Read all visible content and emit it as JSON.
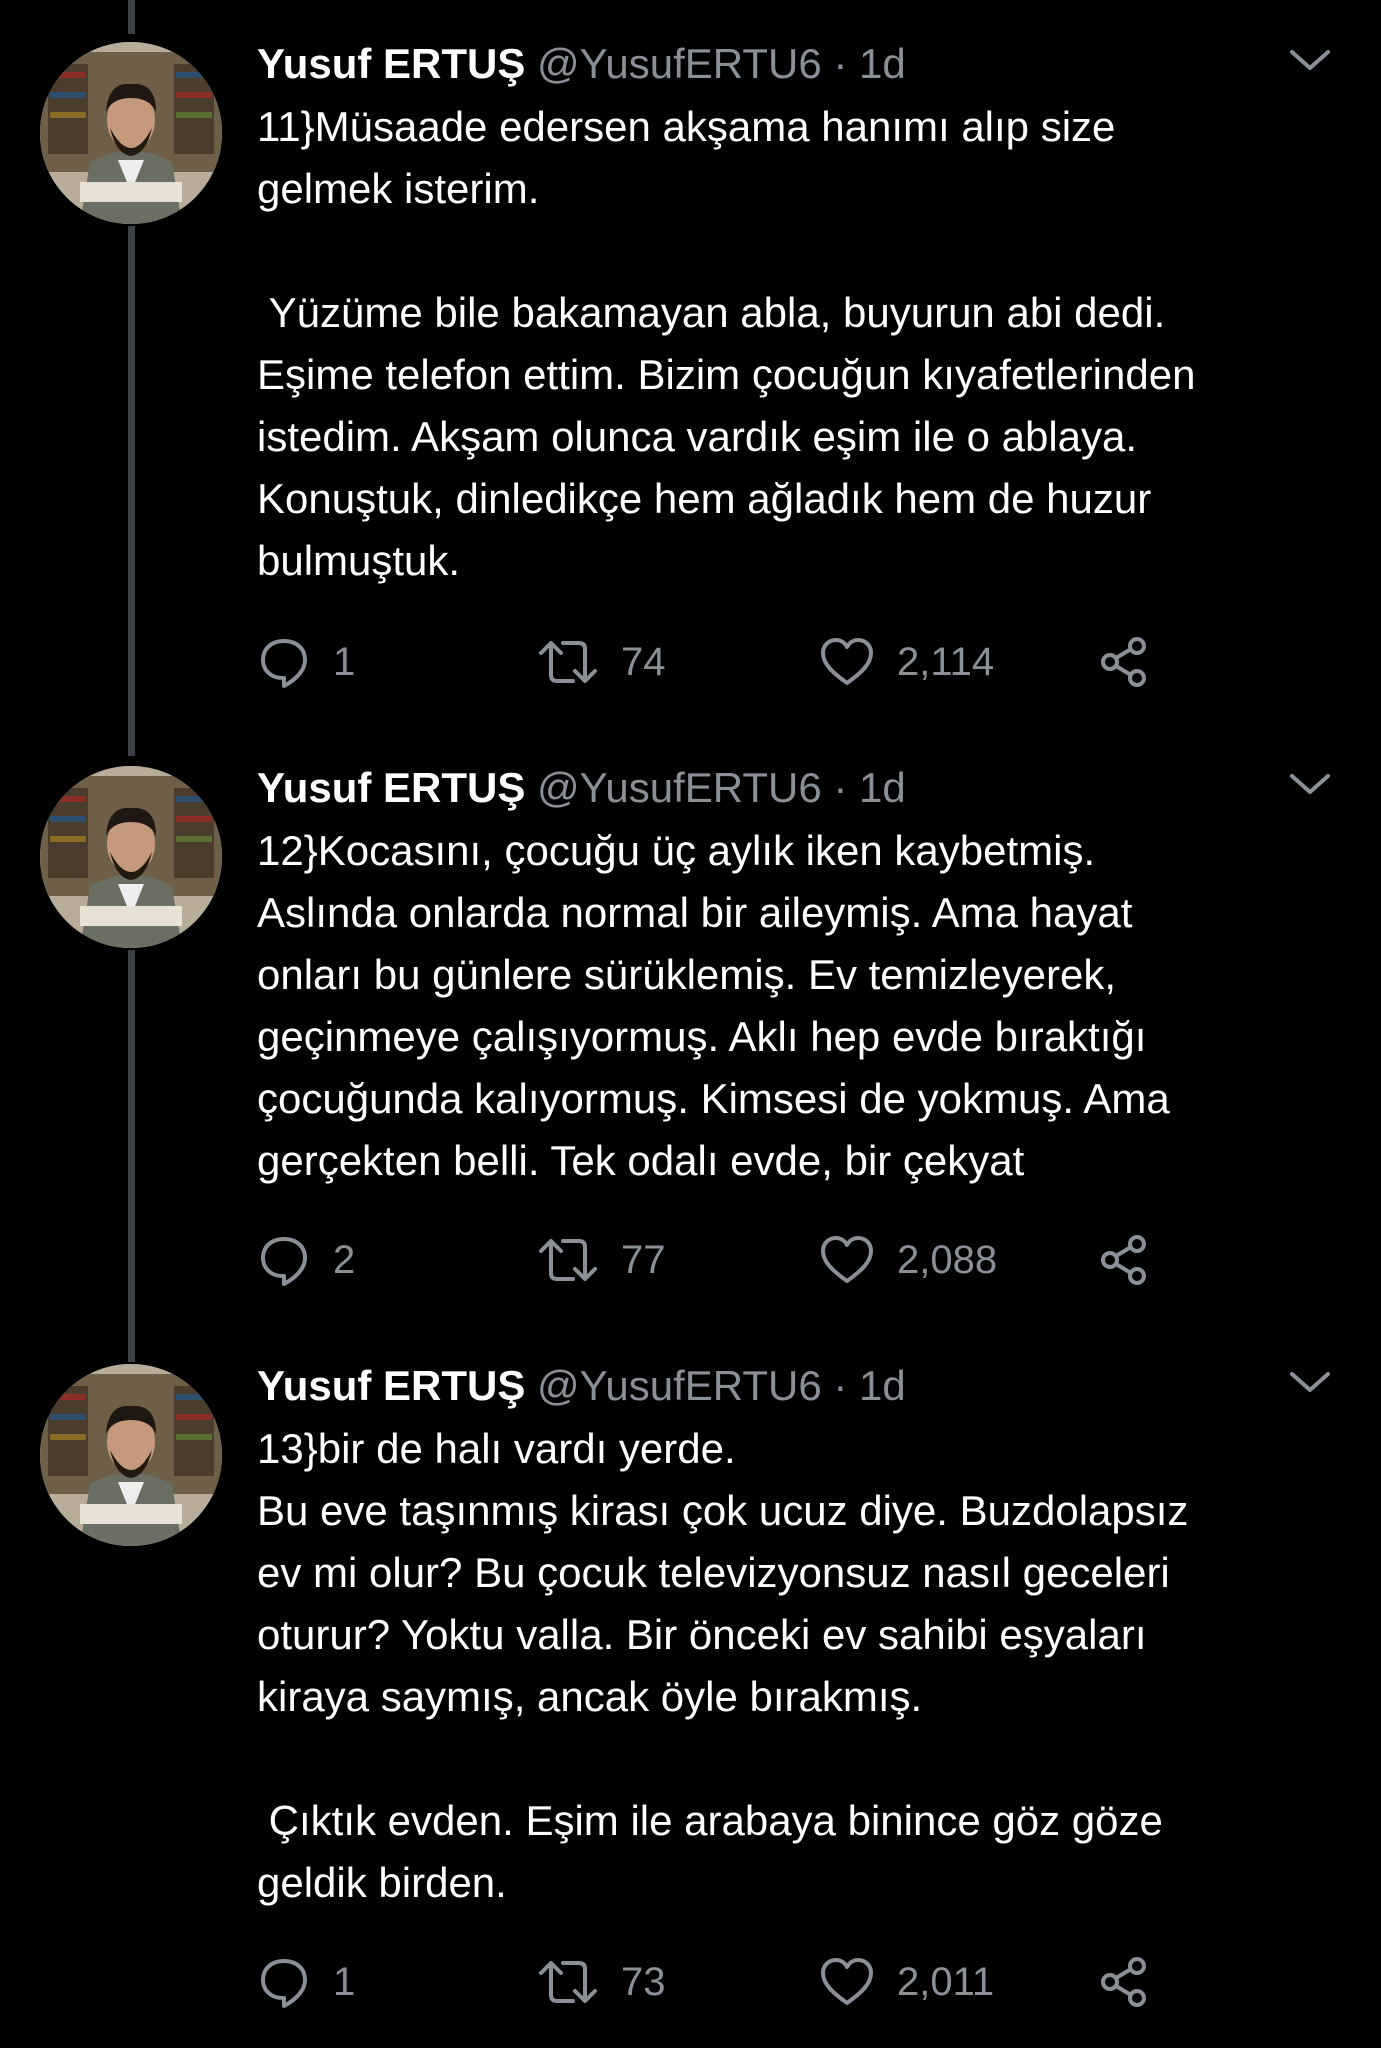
{
  "tweets": [
    {
      "author_name": "Yusuf ERTUŞ",
      "handle": "@YusufERTU6",
      "separator": "·",
      "time": "1d",
      "text": "11}Müsaade edersen akşama hanımı alıp size\ngelmek isterim.\n\n Yüzüme bile bakamayan abla, buyurun abi dedi.\nEşime telefon ettim. Bizim çocuğun kıyafetlerinden\nistedim. Akşam olunca vardık eşim ile o ablaya.\nKonuştuk, dinledikçe hem ağladık hem de huzur\nbulmuştuk.",
      "reply_count": "1",
      "retweet_count": "74",
      "like_count": "2,114"
    },
    {
      "author_name": "Yusuf ERTUŞ",
      "handle": "@YusufERTU6",
      "separator": "·",
      "time": "1d",
      "text": "12}Kocasını, çocuğu üç aylık iken kaybetmiş.\nAslında onlarda normal bir aileymiş. Ama hayat\nonları bu günlere sürüklemiş. Ev temizleyerek,\ngeçinmeye çalışıyormuş. Aklı hep evde bıraktığı\nçocuğunda kalıyormuş. Kimsesi de yokmuş. Ama\ngerçekten belli. Tek odalı evde, bir çekyat",
      "reply_count": "2",
      "retweet_count": "77",
      "like_count": "2,088"
    },
    {
      "author_name": "Yusuf ERTUŞ",
      "handle": "@YusufERTU6",
      "separator": "·",
      "time": "1d",
      "text": "13}bir de halı vardı yerde.\nBu eve taşınmış kirası çok ucuz diye. Buzdolapsız\nev mi olur? Bu çocuk televizyonsuz nasıl geceleri\noturur? Yoktu valla. Bir önceki ev sahibi eşyaları\nkiraya saymış, ancak öyle bırakmış.\n\n Çıktık evden. Eşim ile arabaya binince göz göze\ngeldik birden.",
      "reply_count": "1",
      "retweet_count": "73",
      "like_count": "2,011"
    }
  ],
  "icons": {
    "reply": "reply-icon",
    "retweet": "retweet-icon",
    "like": "heart-icon",
    "share": "share-icon",
    "more": "chevron-down-icon"
  },
  "colors": {
    "background": "#000000",
    "text": "#ffffff",
    "secondary": "#8b9096",
    "thread_line": "#3d4145"
  }
}
